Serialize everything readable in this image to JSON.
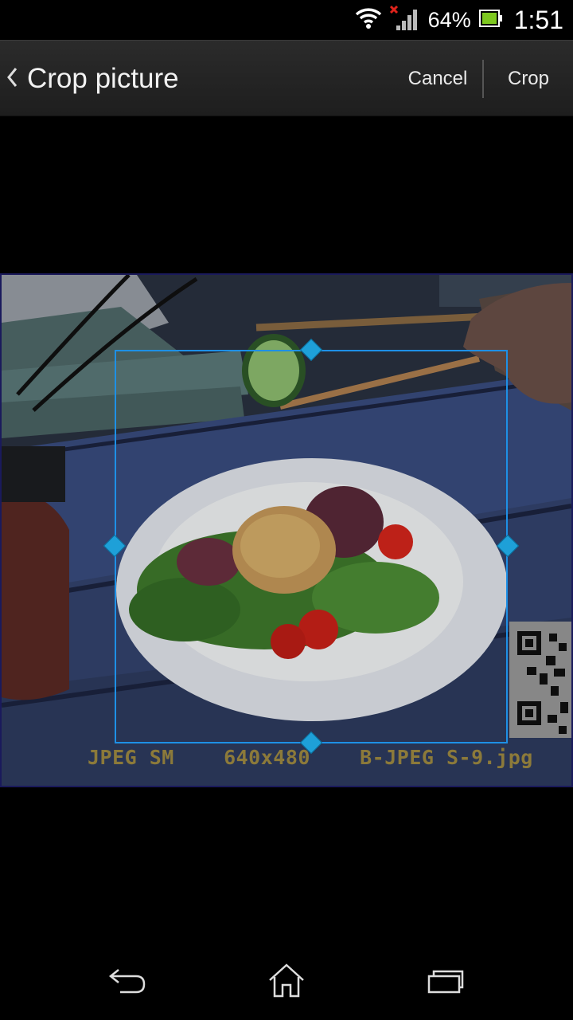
{
  "status_bar": {
    "battery_percent": "64%",
    "time": "1:51",
    "icons": [
      "wifi-icon",
      "signal-icon",
      "battery-icon"
    ]
  },
  "action_bar": {
    "title": "Crop picture",
    "cancel_label": "Cancel",
    "crop_label": "Crop"
  },
  "photo": {
    "caption": "JPEG SM    640x480    B-JPEG S-9.jpg"
  },
  "nav_bar": {
    "icons": [
      "back-icon",
      "home-icon",
      "recent-apps-icon"
    ]
  },
  "colors": {
    "crop_frame": "#1e90e6",
    "handle": "#1ea0d8",
    "battery_fill": "#7ec820",
    "signal_off": "#e0231b"
  }
}
